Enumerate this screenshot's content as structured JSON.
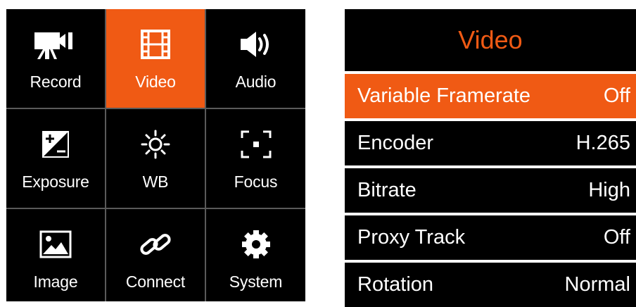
{
  "grid": {
    "tiles": [
      {
        "label": "Record",
        "icon": "video-camera-icon"
      },
      {
        "label": "Video",
        "icon": "film-strip-icon"
      },
      {
        "label": "Audio",
        "icon": "speaker-icon"
      },
      {
        "label": "Exposure",
        "icon": "exposure-icon"
      },
      {
        "label": "WB",
        "icon": "sun-icon"
      },
      {
        "label": "Focus",
        "icon": "focus-frame-icon"
      },
      {
        "label": "Image",
        "icon": "picture-icon"
      },
      {
        "label": "Connect",
        "icon": "link-icon"
      },
      {
        "label": "System",
        "icon": "gear-icon"
      }
    ],
    "selected": "Video"
  },
  "menu": {
    "title": "Video",
    "items": [
      {
        "label": "Variable Framerate",
        "value": "Off"
      },
      {
        "label": "Encoder",
        "value": "H.265"
      },
      {
        "label": "Bitrate",
        "value": "High"
      },
      {
        "label": "Proxy Track",
        "value": "Off"
      },
      {
        "label": "Rotation",
        "value": "Normal"
      }
    ],
    "selected": "Variable Framerate"
  },
  "colors": {
    "accent": "#f05a14",
    "background": "#000000",
    "text": "#ffffff",
    "divider": "#5a5a5a"
  }
}
